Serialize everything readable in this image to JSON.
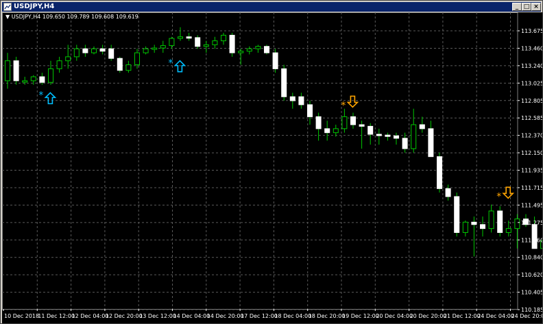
{
  "window": {
    "title": "USDJPY,H4",
    "buttons": {
      "minimize": "_",
      "maximize": "□",
      "close": "×"
    }
  },
  "header": {
    "symbol": "USDJPY,H4",
    "ohlc": "109.650 109.789 109.608 109.619"
  },
  "colors": {
    "background": "#000000",
    "grid": "#5a5a5a",
    "bull_candle": "#000000",
    "bull_outline": "#00c800",
    "bear_candle": "#ffffff",
    "wick": "#00c800",
    "buy_arrow": "#00bfff",
    "sell_arrow": "#ffa500",
    "axis_text": "#ffffff"
  },
  "chart_data": {
    "type": "candlestick",
    "y_ticks": [
      "113.675",
      "113.460",
      "113.240",
      "113.025",
      "112.805",
      "112.585",
      "112.370",
      "112.150",
      "111.935",
      "111.715",
      "111.495",
      "111.275",
      "111.060",
      "110.840",
      "110.620",
      "110.405",
      "110.185"
    ],
    "x_ticks": [
      "10 Dec 2018",
      "11 Dec 12:00",
      "12 Dec 04:00",
      "12 Dec 20:00",
      "13 Dec 12:00",
      "14 Dec 04:00",
      "14 Dec 20:00",
      "17 Dec 12:00",
      "18 Dec 04:00",
      "18 Dec 20:00",
      "19 Dec 12:00",
      "20 Dec 04:00",
      "20 Dec 20:00",
      "21 Dec 12:00",
      "24 Dec 04:00",
      "24 Dec 20:00"
    ],
    "candles": [
      {
        "o": 113.05,
        "h": 113.4,
        "l": 112.95,
        "c": 113.3
      },
      {
        "o": 113.3,
        "h": 113.35,
        "l": 113.0,
        "c": 113.05
      },
      {
        "o": 113.05,
        "h": 113.1,
        "l": 113.0,
        "c": 113.05
      },
      {
        "o": 113.05,
        "h": 113.12,
        "l": 113.0,
        "c": 113.1
      },
      {
        "o": 113.1,
        "h": 113.15,
        "l": 113.0,
        "c": 113.03
      },
      {
        "o": 113.03,
        "h": 113.3,
        "l": 113.0,
        "c": 113.2
      },
      {
        "o": 113.2,
        "h": 113.35,
        "l": 113.15,
        "c": 113.3
      },
      {
        "o": 113.3,
        "h": 113.5,
        "l": 113.2,
        "c": 113.35
      },
      {
        "o": 113.35,
        "h": 113.5,
        "l": 113.3,
        "c": 113.45
      },
      {
        "o": 113.45,
        "h": 113.5,
        "l": 113.35,
        "c": 113.4
      },
      {
        "o": 113.4,
        "h": 113.48,
        "l": 113.38,
        "c": 113.45
      },
      {
        "o": 113.45,
        "h": 113.5,
        "l": 113.38,
        "c": 113.42
      },
      {
        "o": 113.45,
        "h": 113.5,
        "l": 113.3,
        "c": 113.33
      },
      {
        "o": 113.33,
        "h": 113.35,
        "l": 113.15,
        "c": 113.18
      },
      {
        "o": 113.18,
        "h": 113.3,
        "l": 113.15,
        "c": 113.25
      },
      {
        "o": 113.25,
        "h": 113.45,
        "l": 113.2,
        "c": 113.4
      },
      {
        "o": 113.4,
        "h": 113.48,
        "l": 113.38,
        "c": 113.45
      },
      {
        "o": 113.45,
        "h": 113.5,
        "l": 113.4,
        "c": 113.46
      },
      {
        "o": 113.46,
        "h": 113.55,
        "l": 113.4,
        "c": 113.49
      },
      {
        "o": 113.49,
        "h": 113.6,
        "l": 113.45,
        "c": 113.58
      },
      {
        "o": 113.58,
        "h": 113.72,
        "l": 113.55,
        "c": 113.6
      },
      {
        "o": 113.6,
        "h": 113.65,
        "l": 113.55,
        "c": 113.59
      },
      {
        "o": 113.59,
        "h": 113.62,
        "l": 113.45,
        "c": 113.48
      },
      {
        "o": 113.48,
        "h": 113.55,
        "l": 113.4,
        "c": 113.5
      },
      {
        "o": 113.5,
        "h": 113.6,
        "l": 113.45,
        "c": 113.55
      },
      {
        "o": 113.55,
        "h": 113.65,
        "l": 113.5,
        "c": 113.62
      },
      {
        "o": 113.62,
        "h": 113.65,
        "l": 113.35,
        "c": 113.4
      },
      {
        "o": 113.4,
        "h": 113.45,
        "l": 113.25,
        "c": 113.42
      },
      {
        "o": 113.42,
        "h": 113.48,
        "l": 113.38,
        "c": 113.45
      },
      {
        "o": 113.45,
        "h": 113.5,
        "l": 113.4,
        "c": 113.48
      },
      {
        "o": 113.48,
        "h": 113.5,
        "l": 113.38,
        "c": 113.4
      },
      {
        "o": 113.4,
        "h": 113.45,
        "l": 113.15,
        "c": 113.2
      },
      {
        "o": 113.2,
        "h": 113.25,
        "l": 112.8,
        "c": 112.85
      },
      {
        "o": 112.85,
        "h": 112.9,
        "l": 112.7,
        "c": 112.8
      },
      {
        "o": 112.85,
        "h": 112.9,
        "l": 112.7,
        "c": 112.75
      },
      {
        "o": 112.75,
        "h": 112.8,
        "l": 112.5,
        "c": 112.6
      },
      {
        "o": 112.6,
        "h": 112.65,
        "l": 112.3,
        "c": 112.45
      },
      {
        "o": 112.45,
        "h": 112.55,
        "l": 112.3,
        "c": 112.4
      },
      {
        "o": 112.4,
        "h": 112.5,
        "l": 112.35,
        "c": 112.45
      },
      {
        "o": 112.45,
        "h": 112.7,
        "l": 112.4,
        "c": 112.6
      },
      {
        "o": 112.6,
        "h": 112.65,
        "l": 112.45,
        "c": 112.5
      },
      {
        "o": 112.5,
        "h": 112.55,
        "l": 112.2,
        "c": 112.48
      },
      {
        "o": 112.48,
        "h": 112.52,
        "l": 112.25,
        "c": 112.38
      },
      {
        "o": 112.38,
        "h": 112.45,
        "l": 112.25,
        "c": 112.37
      },
      {
        "o": 112.37,
        "h": 112.4,
        "l": 112.3,
        "c": 112.36
      },
      {
        "o": 112.36,
        "h": 112.4,
        "l": 112.25,
        "c": 112.33
      },
      {
        "o": 112.33,
        "h": 112.4,
        "l": 112.15,
        "c": 112.2
      },
      {
        "o": 112.2,
        "h": 112.7,
        "l": 112.15,
        "c": 112.5
      },
      {
        "o": 112.5,
        "h": 112.6,
        "l": 112.4,
        "c": 112.45
      },
      {
        "o": 112.45,
        "h": 112.55,
        "l": 112.1,
        "c": 112.1
      },
      {
        "o": 112.1,
        "h": 112.15,
        "l": 111.65,
        "c": 111.7
      },
      {
        "o": 111.7,
        "h": 111.75,
        "l": 111.55,
        "c": 111.6
      },
      {
        "o": 111.6,
        "h": 111.65,
        "l": 111.1,
        "c": 111.15
      },
      {
        "o": 111.15,
        "h": 111.3,
        "l": 111.1,
        "c": 111.28
      },
      {
        "o": 111.28,
        "h": 111.35,
        "l": 110.85,
        "c": 111.25
      },
      {
        "o": 111.25,
        "h": 111.35,
        "l": 111.1,
        "c": 111.2
      },
      {
        "o": 111.2,
        "h": 111.5,
        "l": 111.15,
        "c": 111.42
      },
      {
        "o": 111.42,
        "h": 111.48,
        "l": 111.1,
        "c": 111.15
      },
      {
        "o": 111.15,
        "h": 111.3,
        "l": 111.1,
        "c": 111.2
      },
      {
        "o": 111.2,
        "h": 111.38,
        "l": 110.95,
        "c": 111.32
      },
      {
        "o": 111.32,
        "h": 111.38,
        "l": 111.22,
        "c": 111.25
      },
      {
        "o": 111.25,
        "h": 111.35,
        "l": 110.95,
        "c": 110.95
      },
      {
        "o": 110.95,
        "h": 111.2,
        "l": 110.9,
        "c": 111.05
      },
      {
        "o": 111.05,
        "h": 111.15,
        "l": 111.0,
        "c": 111.1
      },
      {
        "o": 111.1,
        "h": 111.15,
        "l": 111.05,
        "c": 111.08
      },
      {
        "o": 111.08,
        "h": 111.1,
        "l": 110.65,
        "c": 110.7
      },
      {
        "o": 110.7,
        "h": 110.75,
        "l": 110.25,
        "c": 110.45
      },
      {
        "o": 110.45,
        "h": 110.48,
        "l": 110.35,
        "c": 110.38
      }
    ],
    "signals": [
      {
        "type": "buy",
        "index": 4,
        "price": 112.9
      },
      {
        "type": "buy",
        "index": 19,
        "price": 113.3
      },
      {
        "type": "sell",
        "index": 39,
        "price": 112.72
      },
      {
        "type": "sell",
        "index": 57,
        "price": 111.58
      }
    ]
  }
}
